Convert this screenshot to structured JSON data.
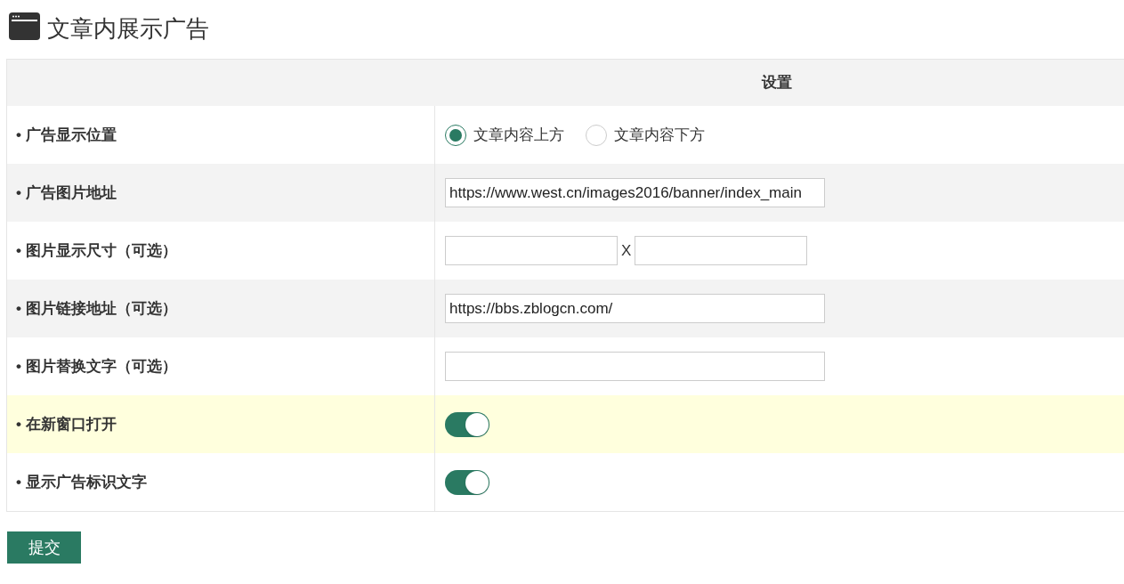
{
  "title": "文章内展示广告",
  "table": {
    "columns": [
      "设置"
    ],
    "rows": [
      {
        "label": "• 广告显示位置",
        "kind": "radio",
        "highlighted": false,
        "options": [
          {
            "label": "文章内容上方",
            "selected": true
          },
          {
            "label": "文章内容下方",
            "selected": false
          }
        ]
      },
      {
        "label": "• 广告图片地址",
        "kind": "text",
        "highlighted": false,
        "value": "https://www.west.cn/images2016/banner/index_main"
      },
      {
        "label": "• 图片显示尺寸（可选）",
        "kind": "size",
        "highlighted": false,
        "separator": "X"
      },
      {
        "label": "• 图片链接地址（可选）",
        "kind": "text",
        "highlighted": false,
        "value": "https://bbs.zblogcn.com/"
      },
      {
        "label": "• 图片替换文字（可选）",
        "kind": "text",
        "highlighted": false
      },
      {
        "label": "• 在新窗口打开",
        "kind": "toggle",
        "highlighted": true,
        "on": true
      },
      {
        "label": "• 显示广告标识文字",
        "kind": "toggle",
        "highlighted": false,
        "on": true
      }
    ]
  },
  "submit": "提交"
}
